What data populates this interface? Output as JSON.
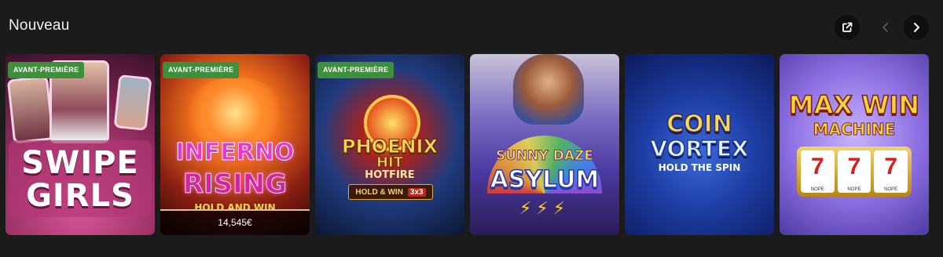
{
  "header": {
    "title": "Nouveau",
    "external_icon": "external-link-icon",
    "prev_icon": "chevron-left-icon",
    "next_icon": "chevron-right-icon"
  },
  "games": [
    {
      "logo_line1": "SWIPE",
      "logo_line2": "GIRLS",
      "badge": "AVANT-PREMIÈRE",
      "colors": [
        "#c2417f",
        "#5b1a3e"
      ]
    },
    {
      "logo_line1": "INFERNO",
      "logo_line2": "RISING",
      "logo_line3": "HOLD AND WIN",
      "badge": "AVANT-PREMIÈRE",
      "jackpot": "14,545€",
      "colors": [
        "#e8731c",
        "#3a0c0a"
      ]
    },
    {
      "logo_line1": "PHOENIX",
      "logo_line2": "HIT",
      "logo_line3": "HOTFIRE",
      "logo_line4": "HOLD & WIN",
      "logo_line5": "3x3",
      "badge": "AVANT-PREMIÈRE",
      "colors": [
        "#1f3e86",
        "#0b1632"
      ]
    },
    {
      "logo_line1": "SUNNY DAZE",
      "logo_line2": "ASYLUM",
      "colors": [
        "#7b5bd0",
        "#2a1c57"
      ]
    },
    {
      "logo_line1": "COIN",
      "logo_line2": "VORTEX",
      "logo_line3": "HOLD THE SPIN",
      "colors": [
        "#2f56c8",
        "#0b1a5a"
      ]
    },
    {
      "logo_line1": "MAX WIN",
      "logo_line2": "MACHINE",
      "reel_symbol": "7",
      "reel_caption": "NOPE",
      "colors": [
        "#a68bf0",
        "#4e3aa1"
      ]
    }
  ]
}
